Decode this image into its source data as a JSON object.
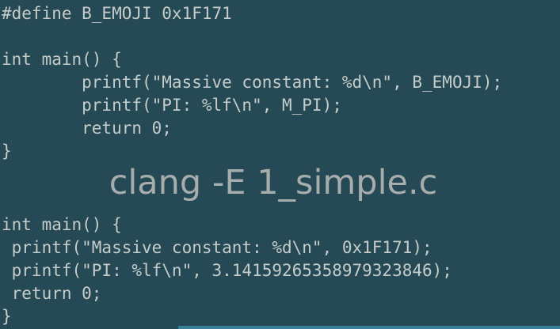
{
  "source_code": {
    "lines": [
      "#define B_EMOJI 0x1F171",
      "",
      "int main() {",
      "        printf(\"Massive constant: %d\\n\", B_EMOJI);",
      "        printf(\"PI: %lf\\n\", M_PI);",
      "        return 0;",
      "}"
    ]
  },
  "caption": "clang -E 1_simple.c",
  "preprocessed_code": {
    "lines": [
      "int main() {",
      " printf(\"Massive constant: %d\\n\", 0x1F171);",
      " printf(\"PI: %lf\\n\", 3.14159265358979323846);",
      " return 0;",
      "}"
    ]
  },
  "colors": {
    "background": "#254a55",
    "code_text": "#c5ccca",
    "caption_text": "#a6adac",
    "accent": "#3a7f98"
  }
}
